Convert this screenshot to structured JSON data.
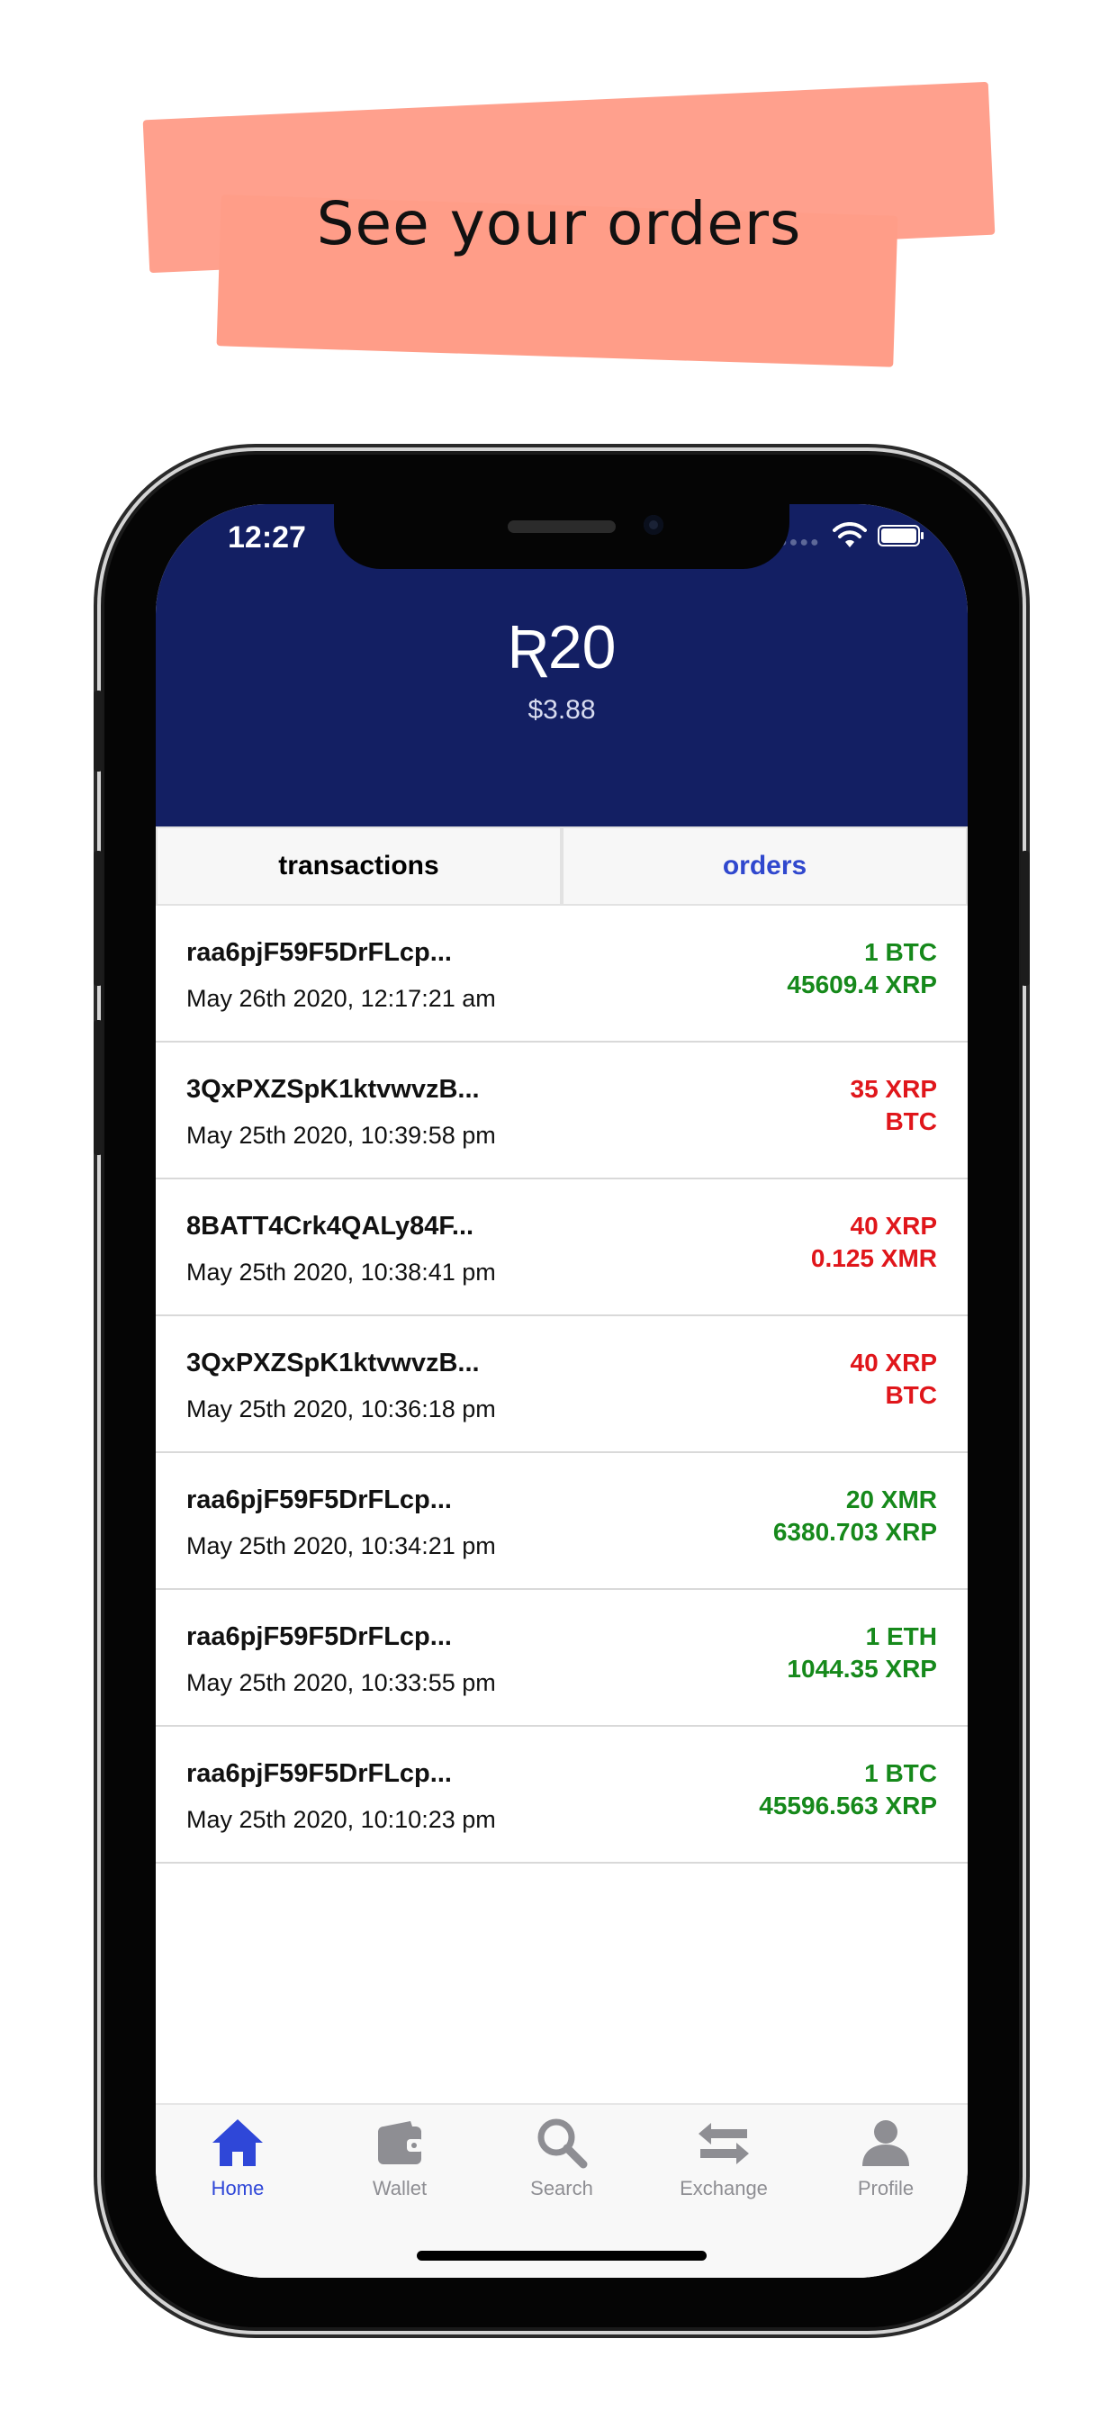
{
  "banner": {
    "title": "See your orders"
  },
  "status_bar": {
    "time": "12:27",
    "wifi_icon": "wifi-icon",
    "battery_icon": "battery-icon"
  },
  "header": {
    "balance": "Ʀ20",
    "balance_usd": "$3.88"
  },
  "tabs": [
    {
      "label": "transactions",
      "selected": false
    },
    {
      "label": "orders",
      "selected": true
    }
  ],
  "orders": [
    {
      "id": "raa6pjF59F5DrFLcp...",
      "date": "May 26th 2020, 12:17:21 am",
      "line1": "1 BTC",
      "line2": "45609.4 XRP",
      "color": "#16891b"
    },
    {
      "id": "3QxPXZSpK1ktvwvzB...",
      "date": "May 25th 2020, 10:39:58 pm",
      "line1": "35 XRP",
      "line2": "BTC",
      "color": "#e0161b"
    },
    {
      "id": "8BATT4Crk4QALy84F...",
      "date": "May 25th 2020, 10:38:41 pm",
      "line1": "40 XRP",
      "line2": "0.125 XMR",
      "color": "#e0161b"
    },
    {
      "id": "3QxPXZSpK1ktvwvzB...",
      "date": "May 25th 2020, 10:36:18 pm",
      "line1": "40 XRP",
      "line2": "BTC",
      "color": "#e0161b"
    },
    {
      "id": "raa6pjF59F5DrFLcp...",
      "date": "May 25th 2020, 10:34:21 pm",
      "line1": "20 XMR",
      "line2": "6380.703 XRP",
      "color": "#16891b"
    },
    {
      "id": "raa6pjF59F5DrFLcp...",
      "date": "May 25th 2020, 10:33:55 pm",
      "line1": "1 ETH",
      "line2": "1044.35 XRP",
      "color": "#16891b"
    },
    {
      "id": "raa6pjF59F5DrFLcp...",
      "date": "May 25th 2020, 10:10:23 pm",
      "line1": "1 BTC",
      "line2": "45596.563 XRP",
      "color": "#16891b"
    }
  ],
  "tabbar": [
    {
      "label": "Home",
      "icon": "home-icon",
      "active": true
    },
    {
      "label": "Wallet",
      "icon": "wallet-icon",
      "active": false
    },
    {
      "label": "Search",
      "icon": "search-icon",
      "active": false
    },
    {
      "label": "Exchange",
      "icon": "exchange-icon",
      "active": false
    },
    {
      "label": "Profile",
      "icon": "profile-icon",
      "active": false
    }
  ],
  "colors": {
    "header_bg": "#131f63",
    "accent": "#3048ce",
    "positive": "#16891b",
    "negative": "#e0161b",
    "banner": "#ffa08d"
  }
}
